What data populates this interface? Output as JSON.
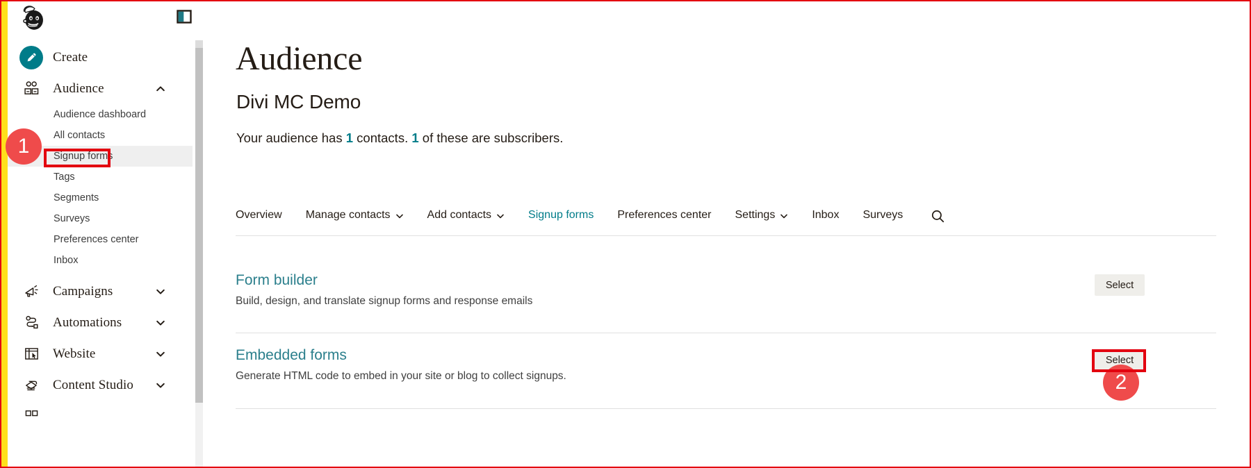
{
  "brand": {
    "logo_icon": "mailchimp-freddie-logo",
    "accent_teal": "#007c89",
    "accent_yellow": "#ffe01b",
    "annotation_red": "#e3000f"
  },
  "sidebar": {
    "panel_toggle_icon": "panel-collapse-icon",
    "items": [
      {
        "label": "Create",
        "icon": "pencil-icon",
        "type": "primary",
        "has_chevron": false,
        "badge": true
      },
      {
        "label": "Audience",
        "icon": "audience-people-icon",
        "type": "primary",
        "has_chevron": true,
        "chevron": "up"
      },
      {
        "label": "Audience dashboard",
        "type": "sub",
        "active": false
      },
      {
        "label": "All contacts",
        "type": "sub",
        "active": false
      },
      {
        "label": "Signup forms",
        "type": "sub",
        "active": true
      },
      {
        "label": "Tags",
        "type": "sub",
        "active": false
      },
      {
        "label": "Segments",
        "type": "sub",
        "active": false
      },
      {
        "label": "Surveys",
        "type": "sub",
        "active": false
      },
      {
        "label": "Preferences center",
        "type": "sub",
        "active": false
      },
      {
        "label": "Inbox",
        "type": "sub",
        "active": false
      },
      {
        "label": "Campaigns",
        "icon": "megaphone-icon",
        "type": "primary",
        "has_chevron": true,
        "chevron": "down"
      },
      {
        "label": "Automations",
        "icon": "automations-flow-icon",
        "type": "primary",
        "has_chevron": true,
        "chevron": "down"
      },
      {
        "label": "Website",
        "icon": "website-window-icon",
        "type": "primary",
        "has_chevron": true,
        "chevron": "down"
      },
      {
        "label": "Content Studio",
        "icon": "content-studio-icon",
        "type": "primary",
        "has_chevron": true,
        "chevron": "down"
      }
    ]
  },
  "main": {
    "page_title": "Audience",
    "audience_name": "Divi MC Demo",
    "stats": {
      "prefix": "Your audience has ",
      "contacts_count": "1",
      "middle": " contacts. ",
      "subscribers_count": "1",
      "suffix": " of these are subscribers."
    },
    "tabs": [
      {
        "label": "Overview",
        "dropdown": false,
        "active": false
      },
      {
        "label": "Manage contacts",
        "dropdown": true,
        "active": false
      },
      {
        "label": "Add contacts",
        "dropdown": true,
        "active": false
      },
      {
        "label": "Signup forms",
        "dropdown": false,
        "active": true
      },
      {
        "label": "Preferences center",
        "dropdown": false,
        "active": false
      },
      {
        "label": "Settings",
        "dropdown": true,
        "active": false
      },
      {
        "label": "Inbox",
        "dropdown": false,
        "active": false
      },
      {
        "label": "Surveys",
        "dropdown": false,
        "active": false
      }
    ],
    "search_icon": "search-icon",
    "options": [
      {
        "title": "Form builder",
        "description": "Build, design, and translate signup forms and response emails",
        "button_label": "Select",
        "highlighted": false
      },
      {
        "title": "Embedded forms",
        "description": "Generate HTML code to embed in your site or blog to collect signups.",
        "button_label": "Select",
        "highlighted": true
      }
    ]
  },
  "annotations": [
    {
      "number": "1",
      "target": "sidebar-signup-forms"
    },
    {
      "number": "2",
      "target": "embedded-forms-select-button"
    }
  ]
}
